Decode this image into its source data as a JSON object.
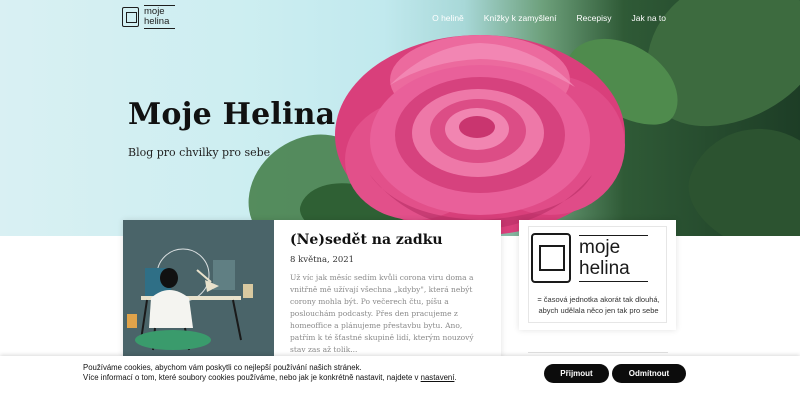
{
  "nav": {
    "logo_text_line1": "moje",
    "logo_text_line2": "helina",
    "items": [
      "O helině",
      "Knížky k zamyšlení",
      "Recepisy",
      "Jak na to"
    ]
  },
  "hero": {
    "title": "Moje Helina",
    "subtitle": "Blog pro chvilky pro sebe"
  },
  "post": {
    "title": "(Ne)sedět na zadku",
    "date": "8 května, 2021",
    "excerpt": "Už víc jak měsíc sedím kvůli corona viru doma a vnitřně mě užívají všechna „kdyby\", která nebýt corony mohla být. Po večerech čtu, píšu a poslouchám podcasty. Přes den pracujeme z homeoffice a plánujeme přestavbu bytu. Ano, patřím k té šťastné skupině lidí, kterým nouzový stav zas až tolik..."
  },
  "sidebar": {
    "logo_line1": "moje",
    "logo_line2": "helina",
    "description": "= časová jednotka akorát tak dlouhá, abych udělala něco jen tak pro sebe"
  },
  "cookie": {
    "line1": "Používáme cookies, abychom vám poskytli co nejlepší používání našich stránek.",
    "line2": "Více informací o tom, které soubory cookies používáme, nebo jak je konkrétně nastavit, najdete v",
    "link": "nastavení",
    "line2_end": ".",
    "accept_label": "Přijmout",
    "decline_label": "Odmítnout"
  },
  "colors": {
    "button_bg": "#0c0c0c",
    "rose_pink": "#e8508f",
    "leaf_green": "#3d6b3f"
  }
}
